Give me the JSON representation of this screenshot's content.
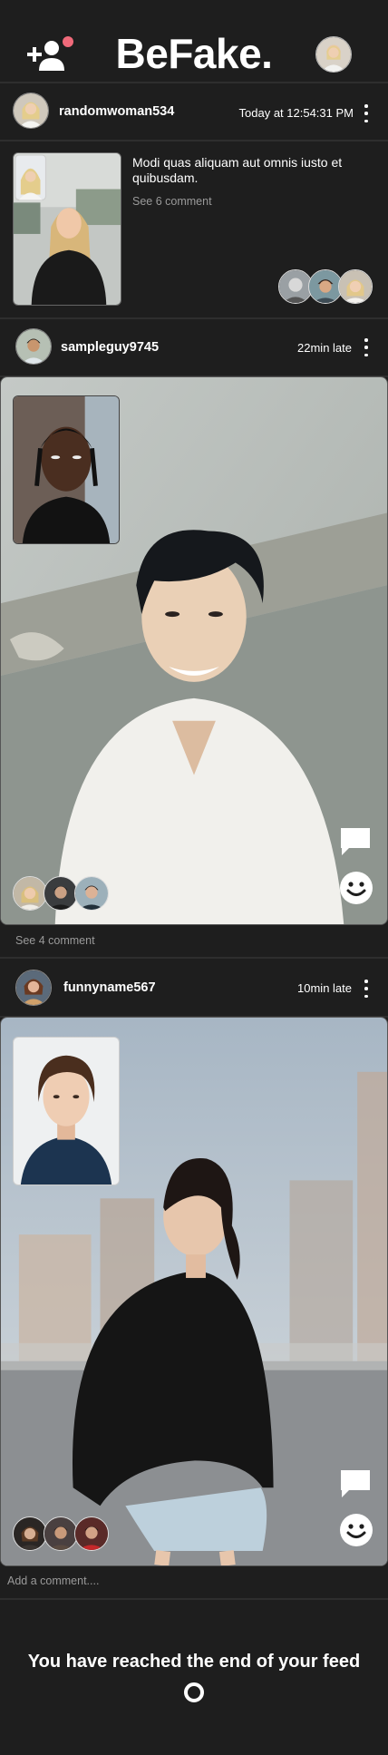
{
  "app": {
    "title": "BeFake."
  },
  "header": {
    "add_friend_icon": "add-user-icon",
    "profile_icon": "avatar"
  },
  "posts": [
    {
      "username": "randomwoman534",
      "time": "Today at 12:54:31 PM",
      "caption": "Modi quas aliquam aut omnis iusto et quibusdam.",
      "comments_label": "See 6 comment"
    },
    {
      "username": "sampleguy9745",
      "time": "22min late",
      "comments_label": "See 4 comment"
    },
    {
      "username": "funnyname567",
      "time": "10min late",
      "comment_placeholder": "Add a comment...."
    }
  ],
  "footer": {
    "end_message": "You have reached the end of your feed"
  },
  "colors": {
    "background": "#1e1e1e",
    "divider": "#2e2e2e",
    "muted_text": "#9a9a9a",
    "notification_dot": "#f06a7a"
  }
}
